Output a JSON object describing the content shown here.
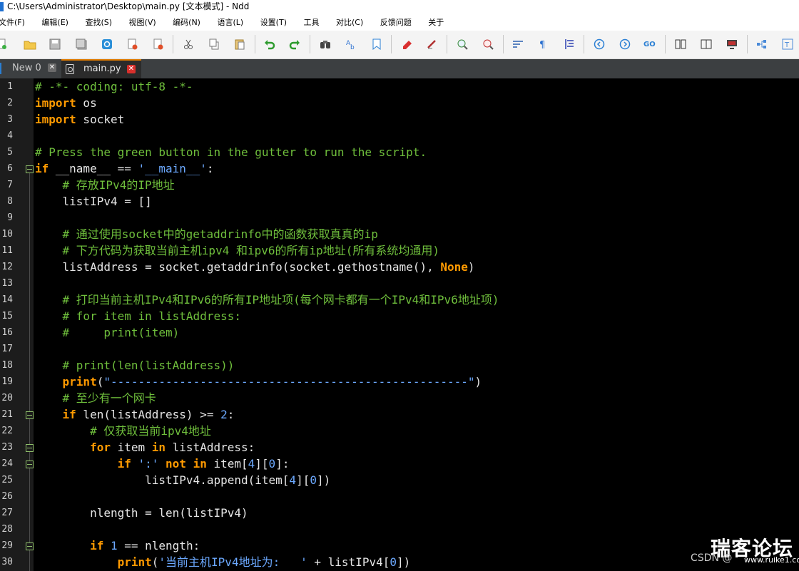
{
  "window": {
    "title": "C:\\Users\\Administrator\\Desktop\\main.py [文本模式] - Ndd"
  },
  "menu": [
    "文件(F)",
    "编辑(E)",
    "查找(S)",
    "视图(V)",
    "编码(N)",
    "语言(L)",
    "设置(T)",
    "工具",
    "对比(C)",
    "反馈问题",
    "关于"
  ],
  "tabs": [
    {
      "label": "New 0",
      "active": false
    },
    {
      "label": "main.py",
      "active": true
    }
  ],
  "line_numbers": [
    "1",
    "2",
    "3",
    "4",
    "5",
    "6",
    "7",
    "8",
    "9",
    "10",
    "11",
    "12",
    "13",
    "14",
    "15",
    "16",
    "17",
    "18",
    "19",
    "20",
    "21",
    "22",
    "23",
    "24",
    "25",
    "26",
    "27",
    "28",
    "29",
    "30"
  ],
  "code": {
    "l1": "# -*- coding: utf-8 -*-",
    "l2a": "import",
    "l2b": " os",
    "l3a": "import",
    "l3b": " socket",
    "l5": "# Press the green button in the gutter to run the script.",
    "l6a": "if",
    "l6b": " __name__ == ",
    "l6c": "'__main__'",
    "l6d": ":",
    "l7": "    # 存放IPv4的IP地址",
    "l8": "    listIPv4 = []",
    "l10": "    # 通过使用socket中的getaddrinfo中的函数获取真真的ip",
    "l11": "    # 下方代码为获取当前主机ipv4 和ipv6的所有ip地址(所有系统均通用)",
    "l12a": "    listAddress = socket.getaddrinfo(socket.gethostname(), ",
    "l12b": "None",
    "l12c": ")",
    "l14": "    # 打印当前主机IPv4和IPv6的所有IP地址项(每个网卡都有一个IPv4和IPv6地址项)",
    "l15": "    # for item in listAddress:",
    "l16": "    #     print(item)",
    "l18": "    # print(len(listAddress))",
    "l19a": "    ",
    "l19b": "print",
    "l19c": "(",
    "l19d": "\"----------------------------------------------------\"",
    "l19e": ")",
    "l20": "    # 至少有一个网卡",
    "l21a": "    ",
    "l21b": "if",
    "l21c": " len(listAddress) >= ",
    "l21d": "2",
    "l21e": ":",
    "l22": "        # 仅获取当前ipv4地址",
    "l23a": "        ",
    "l23b": "for",
    "l23c": " item ",
    "l23d": "in",
    "l23e": " listAddress:",
    "l24a": "            ",
    "l24b": "if",
    "l24c": " ",
    "l24d": "':'",
    "l24e": " ",
    "l24f": "not in",
    "l24g": " item[",
    "l24h": "4",
    "l24i": "][",
    "l24j": "0",
    "l24k": "]:",
    "l25a": "                listIPv4.append(item[",
    "l25b": "4",
    "l25c": "][",
    "l25d": "0",
    "l25e": "])",
    "l27": "        nlength = len(listIPv4)",
    "l29a": "        ",
    "l29b": "if",
    "l29c": " ",
    "l29d": "1",
    "l29e": " == nlength:",
    "l30a": "            ",
    "l30b": "print",
    "l30c": "(",
    "l30d": "'当前主机IPv4地址为:   '",
    "l30e": " + listIPv4[",
    "l30f": "0",
    "l30g": "])"
  },
  "watermark": {
    "main": "瑞客论坛",
    "sub": "CSDN @",
    "url": "www.ruike1.com"
  },
  "colors": {
    "comment": "#6fbf3c",
    "keyword": "#ff9a00",
    "string": "#6ca9ff",
    "number": "#6ca9ff",
    "editor_bg": "#000000",
    "active_tab_accent": "#e07b00"
  },
  "toolbar_icons": [
    "new-file-icon",
    "open-folder-icon",
    "save-icon",
    "save-all-icon",
    "browser-icon",
    "close-icon",
    "close-all-icon",
    "cut-icon",
    "copy-icon",
    "paste-icon",
    "undo-icon",
    "redo-icon",
    "find-icon",
    "replace-icon",
    "bookmark-icon",
    "mark-icon",
    "clear-mark-icon",
    "zoom-in-icon",
    "zoom-out-icon",
    "wrap-icon",
    "paragraph-icon",
    "indent-guide-icon",
    "prev-icon",
    "next-icon",
    "goto-icon",
    "compare-icon",
    "split-view-icon",
    "monitor-icon",
    "tree-icon",
    "bracket-icon"
  ]
}
